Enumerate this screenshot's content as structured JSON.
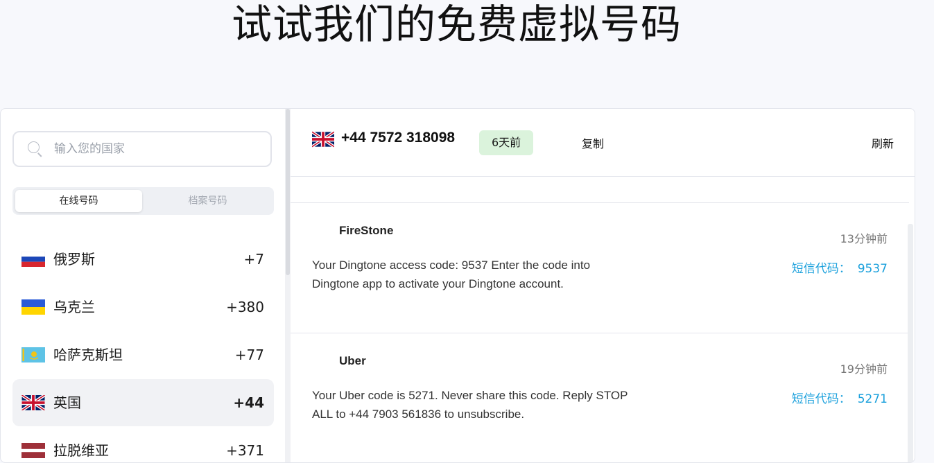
{
  "page_title": "试试我们的免费虚拟号码",
  "sidebar": {
    "search_placeholder": "输入您的国家",
    "tabs": [
      {
        "label": "在线号码",
        "active": true
      },
      {
        "label": "档案号码",
        "active": false
      }
    ],
    "countries": [
      {
        "name": "俄罗斯",
        "code": "+7",
        "flag": "russia-flag-icon"
      },
      {
        "name": "乌克兰",
        "code": "+380",
        "flag": "ukraine-flag-icon"
      },
      {
        "name": "哈萨克斯坦",
        "code": "+77",
        "flag": "kazakhstan-flag-icon"
      },
      {
        "name": "英国",
        "code": "+44",
        "flag": "uk-flag-icon",
        "selected": true
      },
      {
        "name": "拉脱维亚",
        "code": "+371",
        "flag": "latvia-flag-icon"
      }
    ]
  },
  "number_panel": {
    "phone_number": "+44 7572 318098",
    "age_badge": "6天前",
    "copy_label": "复制",
    "refresh_label": "刷新"
  },
  "messages": [
    {
      "sender": "FireStone",
      "time": "13分钟前",
      "body": "Your Dingtone access code: 9537 Enter the code into Dingtone app to activate your Dingtone account.",
      "code_label": "短信代码：",
      "code_value": "9537"
    },
    {
      "sender": "Uber",
      "time": "19分钟前",
      "body": "Your Uber code is 5271. Never share this code. Reply STOP ALL to +44 7903 561836 to unsubscribe.",
      "code_label": "短信代码：",
      "code_value": "5271"
    }
  ],
  "colors": {
    "accent": "#1aa0dc",
    "badge_bg": "#dbf3dc",
    "page_bg": "#f7f8fc"
  }
}
